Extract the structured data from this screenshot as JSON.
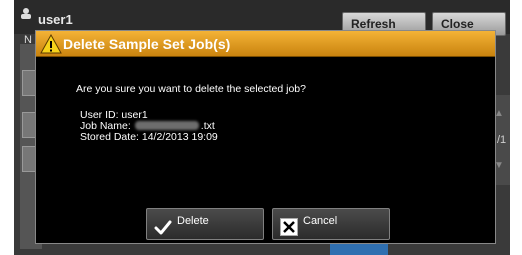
{
  "background": {
    "user_name": "user1",
    "refresh_label": "Refresh",
    "close_label": "Close",
    "side_letter": "N",
    "page_indicator": "/1"
  },
  "dialog": {
    "title": "Delete Sample Set Job(s)",
    "question": "Are you sure you want to delete the selected job?",
    "user_id_line": "User ID: user1",
    "job_name_label": "Job Name:",
    "job_name_suffix": ".txt",
    "stored_date_line": "Stored Date: 14/2/2013 19:09",
    "delete_label": "Delete",
    "cancel_label": "Cancel"
  },
  "icons": {
    "warning": "warning-icon",
    "delete": "checkmark-icon",
    "cancel": "close-x-icon"
  },
  "colors": {
    "header_accent": "#e8a020",
    "dialog_bg": "#000000",
    "button_bg": "#3a3a3a"
  }
}
